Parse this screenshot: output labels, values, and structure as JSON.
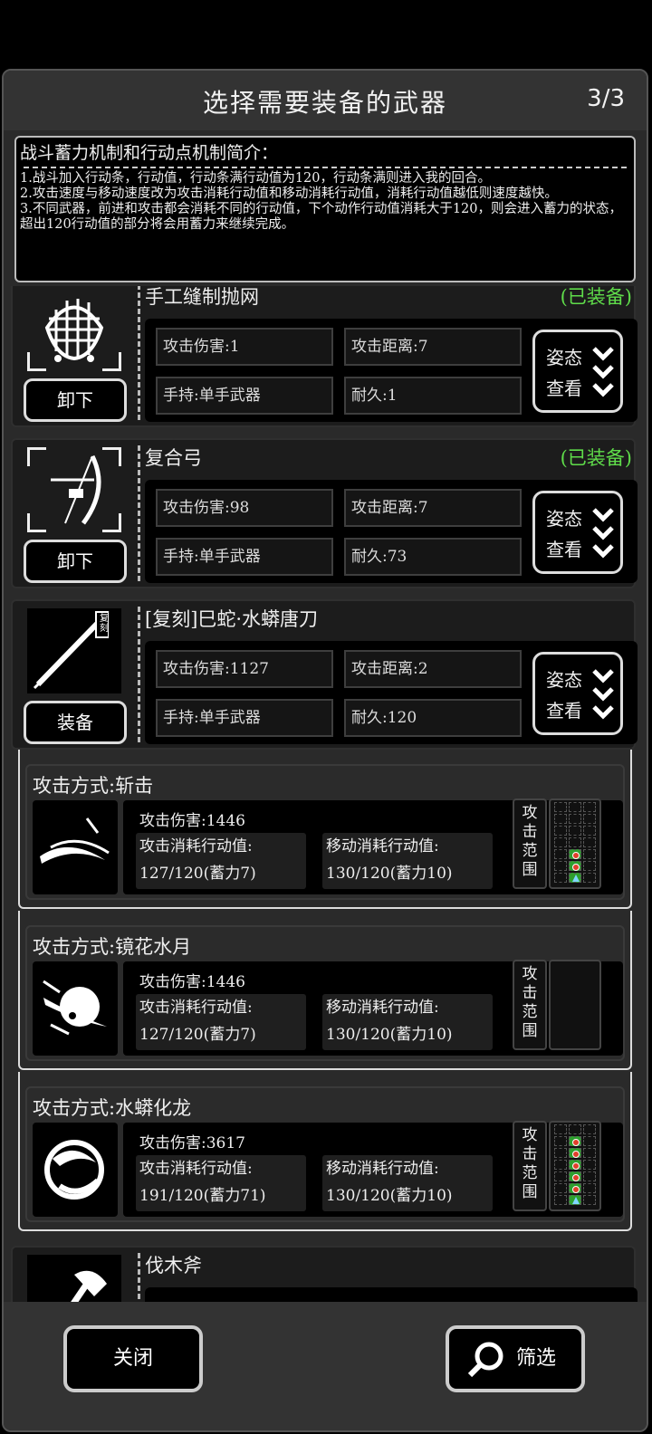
{
  "header": {
    "title": "选择需要装备的武器",
    "page_indicator": "3/3"
  },
  "info": {
    "title": "战斗蓄力机制和行动点机制简介：",
    "lines": [
      "1.战斗加入行动条，行动值，行动条满行动值为120，行动条满则进入我的回合。",
      "2.攻击速度与移动速度改为攻击消耗行动值和移动消耗行动值，消耗行动值越低则速度越快。",
      "3.不同武器，前进和攻击都会消耗不同的行动值，下个动作行动值消耗大于120，则会进入蓄力的状态，超出120行动值的部分将会用蓄力来继续完成。"
    ]
  },
  "weapons": [
    {
      "name": "手工缝制抛网",
      "status": "(已装备)",
      "damage": "攻击伤害:1",
      "range": "攻击距离:7",
      "hold": "手持:单手武器",
      "durability": "耐久:1",
      "button": "卸下",
      "icon": "net-icon"
    },
    {
      "name": "复合弓",
      "status": "(已装备)",
      "damage": "攻击伤害:98",
      "range": "攻击距离:7",
      "hold": "手持:单手武器",
      "durability": "耐久:73",
      "button": "卸下",
      "icon": "bow-icon"
    },
    {
      "name": "[复刻]巳蛇·水蟒唐刀",
      "status": "",
      "damage": "攻击伤害:1127",
      "range": "攻击距离:2",
      "hold": "手持:单手武器",
      "durability": "耐久:120",
      "button": "装备",
      "icon": "tang-sword-icon",
      "badge": "复刻"
    },
    {
      "name": "伐木斧",
      "status": "",
      "icon": "axe-icon"
    }
  ],
  "pose_button": {
    "line1": "姿态",
    "line2": "查看"
  },
  "attacks": [
    {
      "name": "攻击方式:斩击",
      "damage": "攻击伤害:1446",
      "atk_cost_label": "攻击消耗行动值:",
      "atk_cost": "127/120(蓄力7)",
      "move_cost_label": "移动消耗行动值:",
      "move_cost": "130/120(蓄力10)",
      "icon": "slash-icon",
      "range_cells": 2
    },
    {
      "name": "攻击方式:镜花水月",
      "damage": "攻击伤害:1446",
      "atk_cost_label": "攻击消耗行动值:",
      "atk_cost": "127/120(蓄力7)",
      "move_cost_label": "移动消耗行动值:",
      "move_cost": "130/120(蓄力10)",
      "icon": "moon-flower-icon",
      "range_cells": 0
    },
    {
      "name": "攻击方式:水蟒化龙",
      "damage": "攻击伤害:3617",
      "atk_cost_label": "攻击消耗行动值:",
      "atk_cost": "191/120(蓄力71)",
      "move_cost_label": "移动消耗行动值:",
      "move_cost": "130/120(蓄力10)",
      "icon": "serpent-dragon-icon",
      "range_cells": 5
    }
  ],
  "range_label": [
    "攻",
    "击",
    "范",
    "围"
  ],
  "footer": {
    "close": "关闭",
    "filter": "筛选"
  },
  "colors": {
    "equipped": "#5fdc4a",
    "range_cell": "#2e9e2e",
    "target_dot": "#e0402a"
  }
}
